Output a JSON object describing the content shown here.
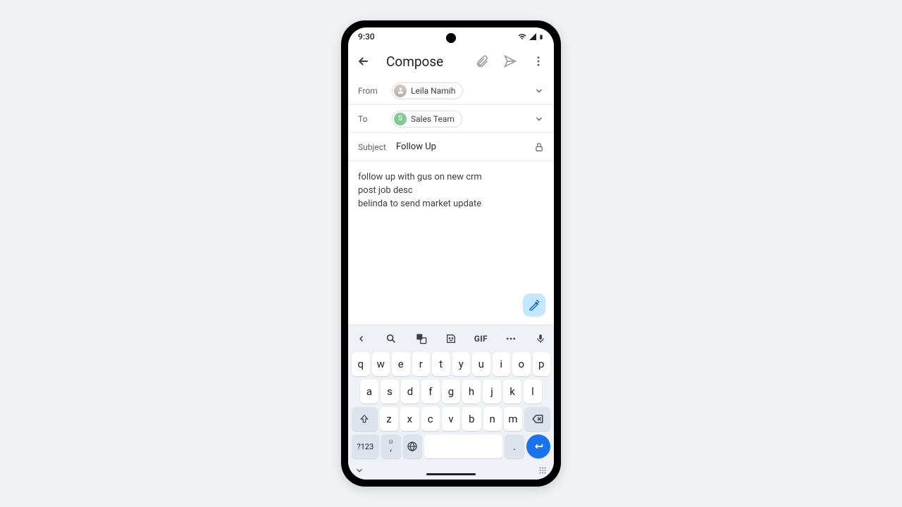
{
  "status": {
    "time": "9:30"
  },
  "appbar": {
    "title": "Compose"
  },
  "from": {
    "label": "From",
    "name": "Leila Namih"
  },
  "to": {
    "label": "To",
    "name": "Sales Team",
    "initial": "S"
  },
  "subject": {
    "label": "Subject",
    "value": "Follow Up"
  },
  "body": {
    "line1": "follow up with gus on new crm",
    "line2": "post job desc",
    "line3": "belinda to send market update"
  },
  "keyboard": {
    "gif": "GIF",
    "row1": {
      "k0": "q",
      "k1": "w",
      "k2": "e",
      "k3": "r",
      "k4": "t",
      "k5": "y",
      "k6": "u",
      "k7": "i",
      "k8": "o",
      "k9": "p"
    },
    "row2": {
      "k0": "a",
      "k1": "s",
      "k2": "d",
      "k3": "f",
      "k4": "g",
      "k5": "h",
      "k6": "j",
      "k7": "k",
      "k8": "l"
    },
    "row3": {
      "k0": "z",
      "k1": "x",
      "k2": "c",
      "k3": "v",
      "k4": "b",
      "k5": "n",
      "k6": "m"
    },
    "symbols": "?123",
    "comma": ",",
    "period": "."
  }
}
